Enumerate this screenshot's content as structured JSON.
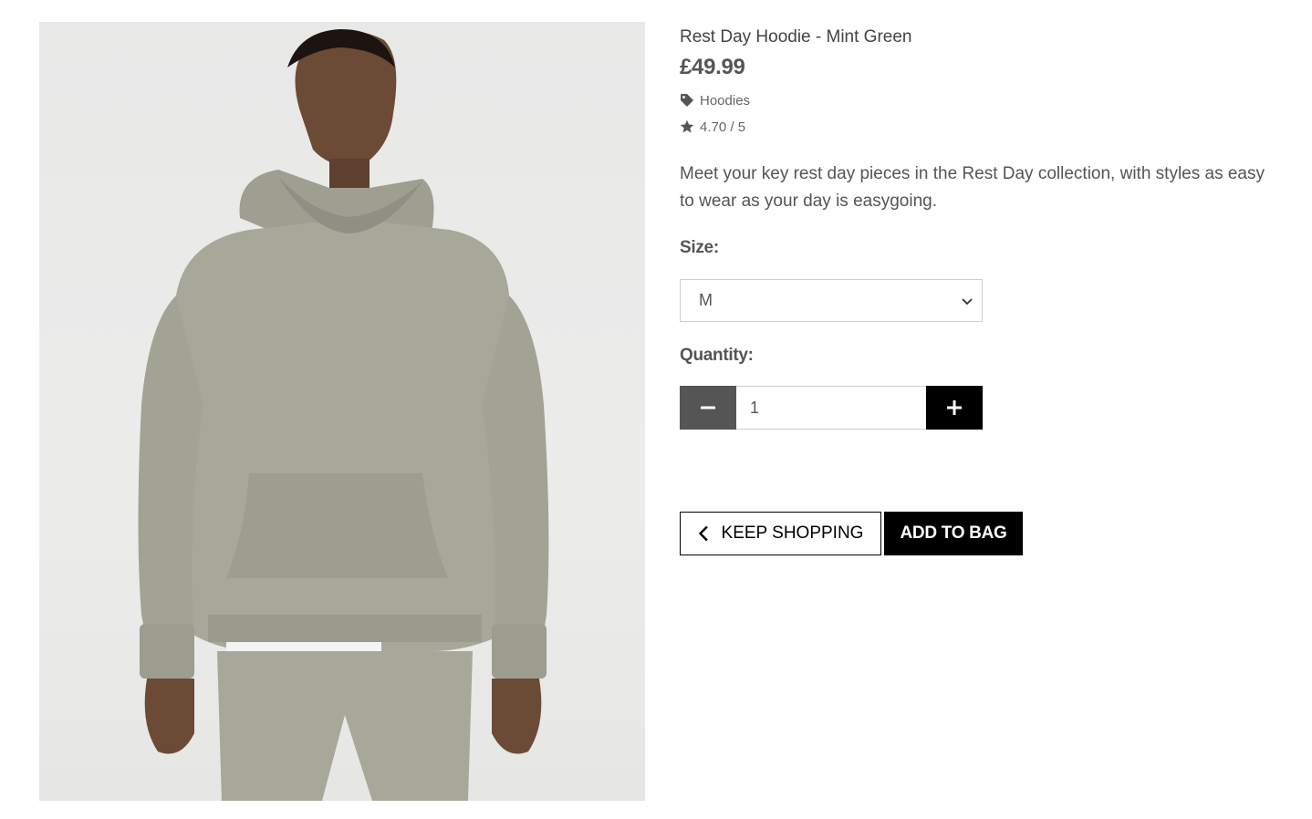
{
  "product": {
    "name": "Rest Day Hoodie - Mint Green",
    "price": "£49.99",
    "category": "Hoodies",
    "category_icon": "tag-icon",
    "rating": "4.70 / 5",
    "rating_icon": "star-icon",
    "description": "Meet your key rest day pieces in the Rest Day collection, with styles as easy to wear as your day is easygoing.",
    "image_subject": "model wearing hoodie"
  },
  "size": {
    "label": "Size:",
    "selected": "M"
  },
  "quantity": {
    "label": "Quantity:",
    "value": "1",
    "decrement_icon": "minus-icon",
    "increment_icon": "plus-icon"
  },
  "actions": {
    "keep_shopping": "KEEP SHOPPING",
    "keep_shopping_icon": "chevron-left-icon",
    "add_to_bag": "ADD TO BAG"
  },
  "colors": {
    "dark_button": "#555555",
    "primary_button": "#000000",
    "hoodie": "#a9a99b",
    "text": "#555555"
  }
}
